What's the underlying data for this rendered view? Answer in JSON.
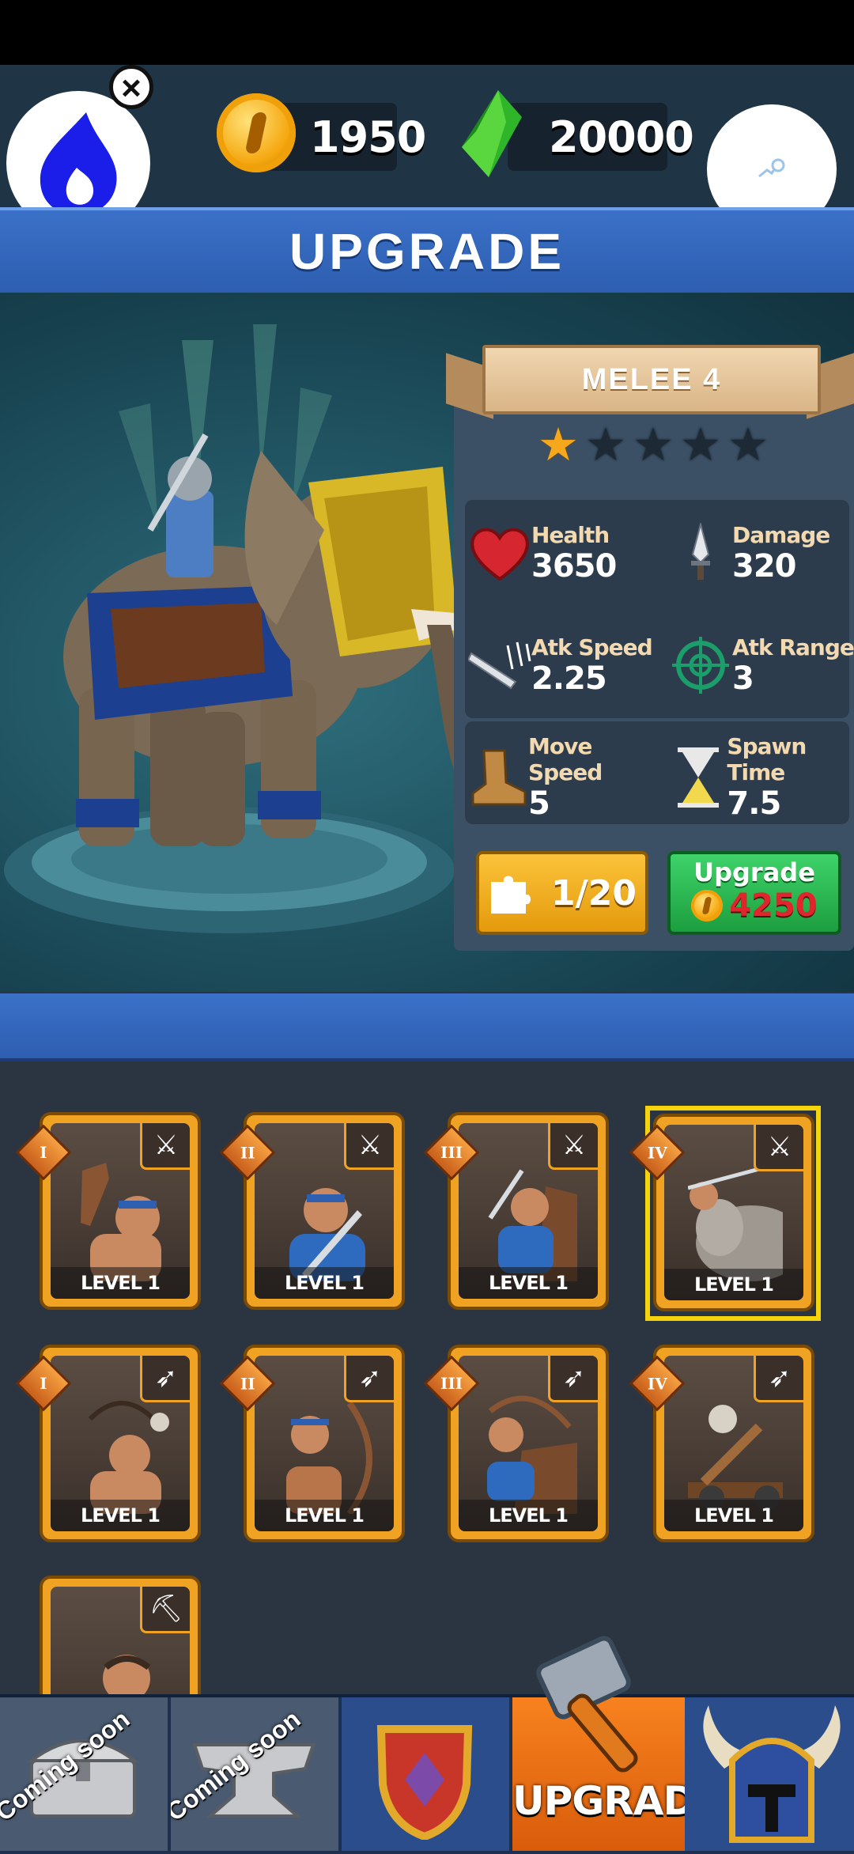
{
  "currency": {
    "coins": "1950",
    "gems": "20000"
  },
  "title": "UPGRADE",
  "unit": {
    "name": "MELEE 4",
    "stars_filled": 1,
    "stars_total": 5,
    "stats": {
      "health_label": "Health",
      "health": "3650",
      "damage_label": "Damage",
      "damage": "320",
      "atk_speed_label": "Atk Speed",
      "atk_speed": "2.25",
      "atk_range_label": "Atk Range",
      "atk_range": "3",
      "move_speed_label": "Move Speed",
      "move_speed": "5",
      "spawn_time_label": "Spawn Time",
      "spawn_time": "7.5"
    },
    "shards": "1/20",
    "upgrade_label": "Upgrade",
    "upgrade_cost": "4250"
  },
  "cards": [
    {
      "tier": "I",
      "level": "LEVEL 1",
      "type_icon": "crossed-swords-icon"
    },
    {
      "tier": "II",
      "level": "LEVEL 1",
      "type_icon": "crossed-swords-icon"
    },
    {
      "tier": "III",
      "level": "LEVEL 1",
      "type_icon": "crossed-swords-icon"
    },
    {
      "tier": "IV",
      "level": "LEVEL 1",
      "type_icon": "crossed-swords-icon",
      "selected": true
    },
    {
      "tier": "I",
      "level": "LEVEL 1",
      "type_icon": "bow-icon"
    },
    {
      "tier": "II",
      "level": "LEVEL 1",
      "type_icon": "bow-icon"
    },
    {
      "tier": "III",
      "level": "LEVEL 1",
      "type_icon": "bow-icon"
    },
    {
      "tier": "IV",
      "level": "LEVEL 1",
      "type_icon": "bow-icon"
    },
    {
      "tier": "",
      "level": "",
      "type_icon": "pickaxe-icon"
    }
  ],
  "nav": {
    "chest_label": "Coming soon",
    "anvil_label": "Coming soon",
    "upgrade_label": "UPGRADE"
  },
  "colors": {
    "accent_blue": "#2d5eb0",
    "card_gold": "#f0a322",
    "cost_red": "#e0252c",
    "upgrade_green": "#1c9e3e"
  }
}
